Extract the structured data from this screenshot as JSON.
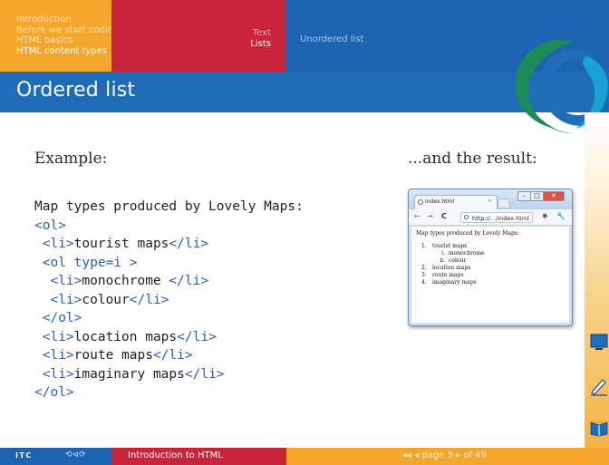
{
  "header": {
    "sections": [
      "Introduction",
      "Before we start coding",
      "HTML basics",
      "HTML content types"
    ],
    "active_section": 3,
    "subsections": [
      "Text",
      "Lists"
    ],
    "active_subsection": 1,
    "frame": "Unordered list"
  },
  "slide": {
    "title": "Ordered list",
    "example_label": "Example:",
    "result_label": "...and the result:",
    "code_lines": [
      "Map types produced by Lovely Maps:",
      "<ol>",
      " <li>tourist maps</li>",
      " <ol type=i >",
      "  <li>monochrome </li>",
      "  <li>colour</li>",
      " </ol>",
      " <li>location maps</li>",
      " <li>route maps</li>",
      " <li>imaginary maps</li>",
      "</ol>"
    ]
  },
  "browser": {
    "tab_title": "index.html",
    "tab_close": "×",
    "url": "http://.../index.html",
    "page_heading": "Map types produced by Lovely Maps:",
    "list": [
      {
        "marker": "1.",
        "text": "tourist maps",
        "level": 1
      },
      {
        "marker": "i.",
        "text": "monochrome",
        "level": 2
      },
      {
        "marker": "ii.",
        "text": "colour",
        "level": 2
      },
      {
        "marker": "2.",
        "text": "location maps",
        "level": 1
      },
      {
        "marker": "3.",
        "text": "route maps",
        "level": 1
      },
      {
        "marker": "4.",
        "text": "imaginary maps",
        "level": 1
      }
    ]
  },
  "footer": {
    "logo": "ITC",
    "nav_glyphs": "⟲⊲⟳",
    "presentation_title": "Introduction to HTML",
    "page_text": "◂◂  ◂ page 5 ▸  of 49"
  },
  "colors": {
    "orange": "#f4a72a",
    "red": "#c9243a",
    "blue": "#1c64b2",
    "code_tag": "#2a5fb0"
  }
}
